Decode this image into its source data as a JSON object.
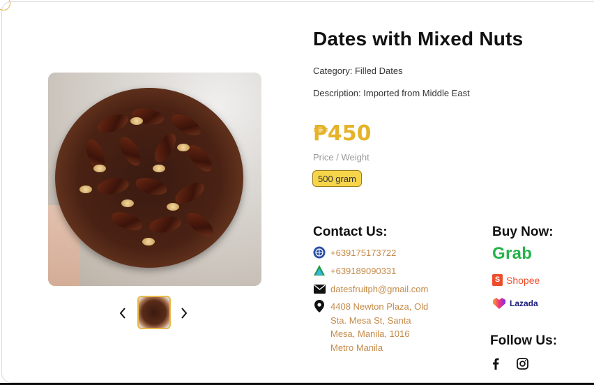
{
  "product": {
    "title": "Dates with Mixed Nuts",
    "category": "Category: Filled Dates",
    "description": "Description: Imported from Middle East",
    "price": "₱450",
    "price_weight_label": "Price / Weight",
    "weight_option": "500 gram"
  },
  "gallery": {
    "prev_icon": "chevron-left-icon",
    "next_icon": "chevron-right-icon",
    "selected_index": 0
  },
  "contact": {
    "heading": "Contact Us:",
    "phone_1": "+639175173722",
    "phone_2": "+639189090331",
    "email": "datesfruitph@gmail.com",
    "address": "4408 Newton Plaza, Old Sta. Mesa St, Santa Mesa, Manila, 1016 Metro Manila"
  },
  "buy": {
    "heading": "Buy Now:",
    "grab": "Grab",
    "shopee": "Shopee",
    "lazada": "Lazada"
  },
  "follow": {
    "heading": "Follow Us:"
  },
  "colors": {
    "accent": "#e5b32a",
    "pill": "#f7d54a",
    "contact_text": "#c58a48",
    "grab": "#26b34a",
    "shopee": "#ee4d2d"
  }
}
